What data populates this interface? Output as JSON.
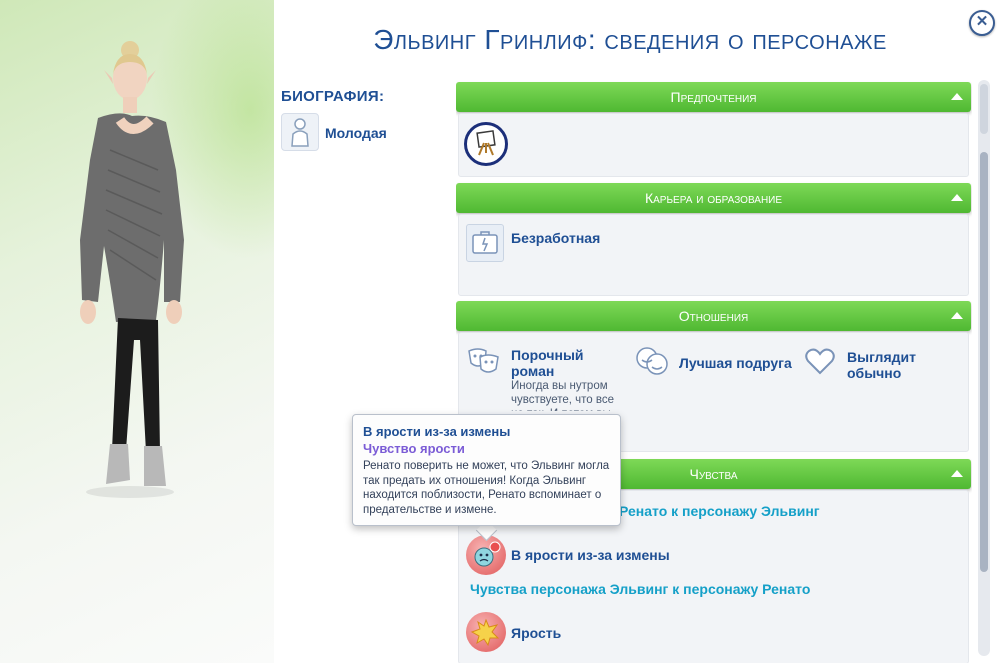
{
  "window": {
    "title": "Эльвинг Гринлиф: сведения о персонаже",
    "close_icon": "close-icon"
  },
  "bio": {
    "label": "Биография:",
    "age_label": "Молодая",
    "age_icon": "young-adult-icon"
  },
  "sections": {
    "preferences": {
      "title": "Предпочтения",
      "icon": "easel-icon"
    },
    "career": {
      "title": "Карьера и образование",
      "status": "Безработная",
      "icon": "career-icon"
    },
    "relationships": {
      "title": "Отношения",
      "items": [
        {
          "label": "Порочный роман",
          "desc": "Иногда вы нутром чувствуете, что все не так. И потом вы",
          "icon": "masks-icon"
        },
        {
          "label": "Лучшая подруга",
          "icon": "friends-icon"
        },
        {
          "label": "Выглядит обычно",
          "icon": "heart-outline-icon"
        }
      ]
    },
    "feelings": {
      "title": "Чувства",
      "from_renato": "Ренато к персонажу Эльвинг",
      "feeling_1": "В ярости из-за измены",
      "to_renato": "Чувства персонажа Эльвинг к персонажу Ренато",
      "feeling_2": "Ярость"
    }
  },
  "tooltip": {
    "title": "В ярости из-за измены",
    "subtitle": "Чувство ярости",
    "body": "Ренато поверить не может, что Эльвинг могла так предать их отношения! Когда Эльвинг находится поблизости, Ренато вспоминает о предательстве и измене."
  },
  "colors": {
    "accent_blue": "#1f4f94",
    "header_green": "#5cc83c",
    "cyan": "#15a0c8",
    "tooltip_purple": "#7b5cd6"
  }
}
